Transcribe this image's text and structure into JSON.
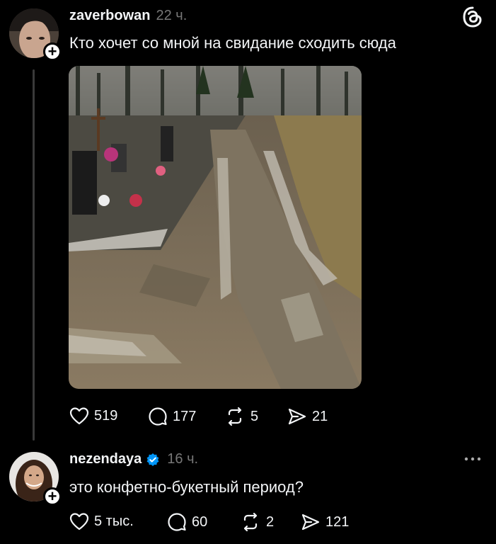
{
  "app": {
    "logo_icon": "threads-logo-icon"
  },
  "posts": [
    {
      "username": "zaverbowan",
      "time": "22 ч.",
      "text": "Кто хочет со мной на свидание сходить сюда",
      "image_subject": "muddy-cemetery-road-photo",
      "actions": {
        "likes": "519",
        "comments": "177",
        "reposts": "5",
        "shares": "21"
      }
    },
    {
      "username": "nezendaya",
      "verified": true,
      "time": "16 ч.",
      "text": "это конфетно-букетный период?",
      "actions": {
        "likes": "5 тыс.",
        "comments": "60",
        "reposts": "2",
        "shares": "121"
      }
    }
  ],
  "colors": {
    "background": "#000000",
    "text": "#f3f5f7",
    "muted": "#777777",
    "verified": "#0095f6"
  }
}
